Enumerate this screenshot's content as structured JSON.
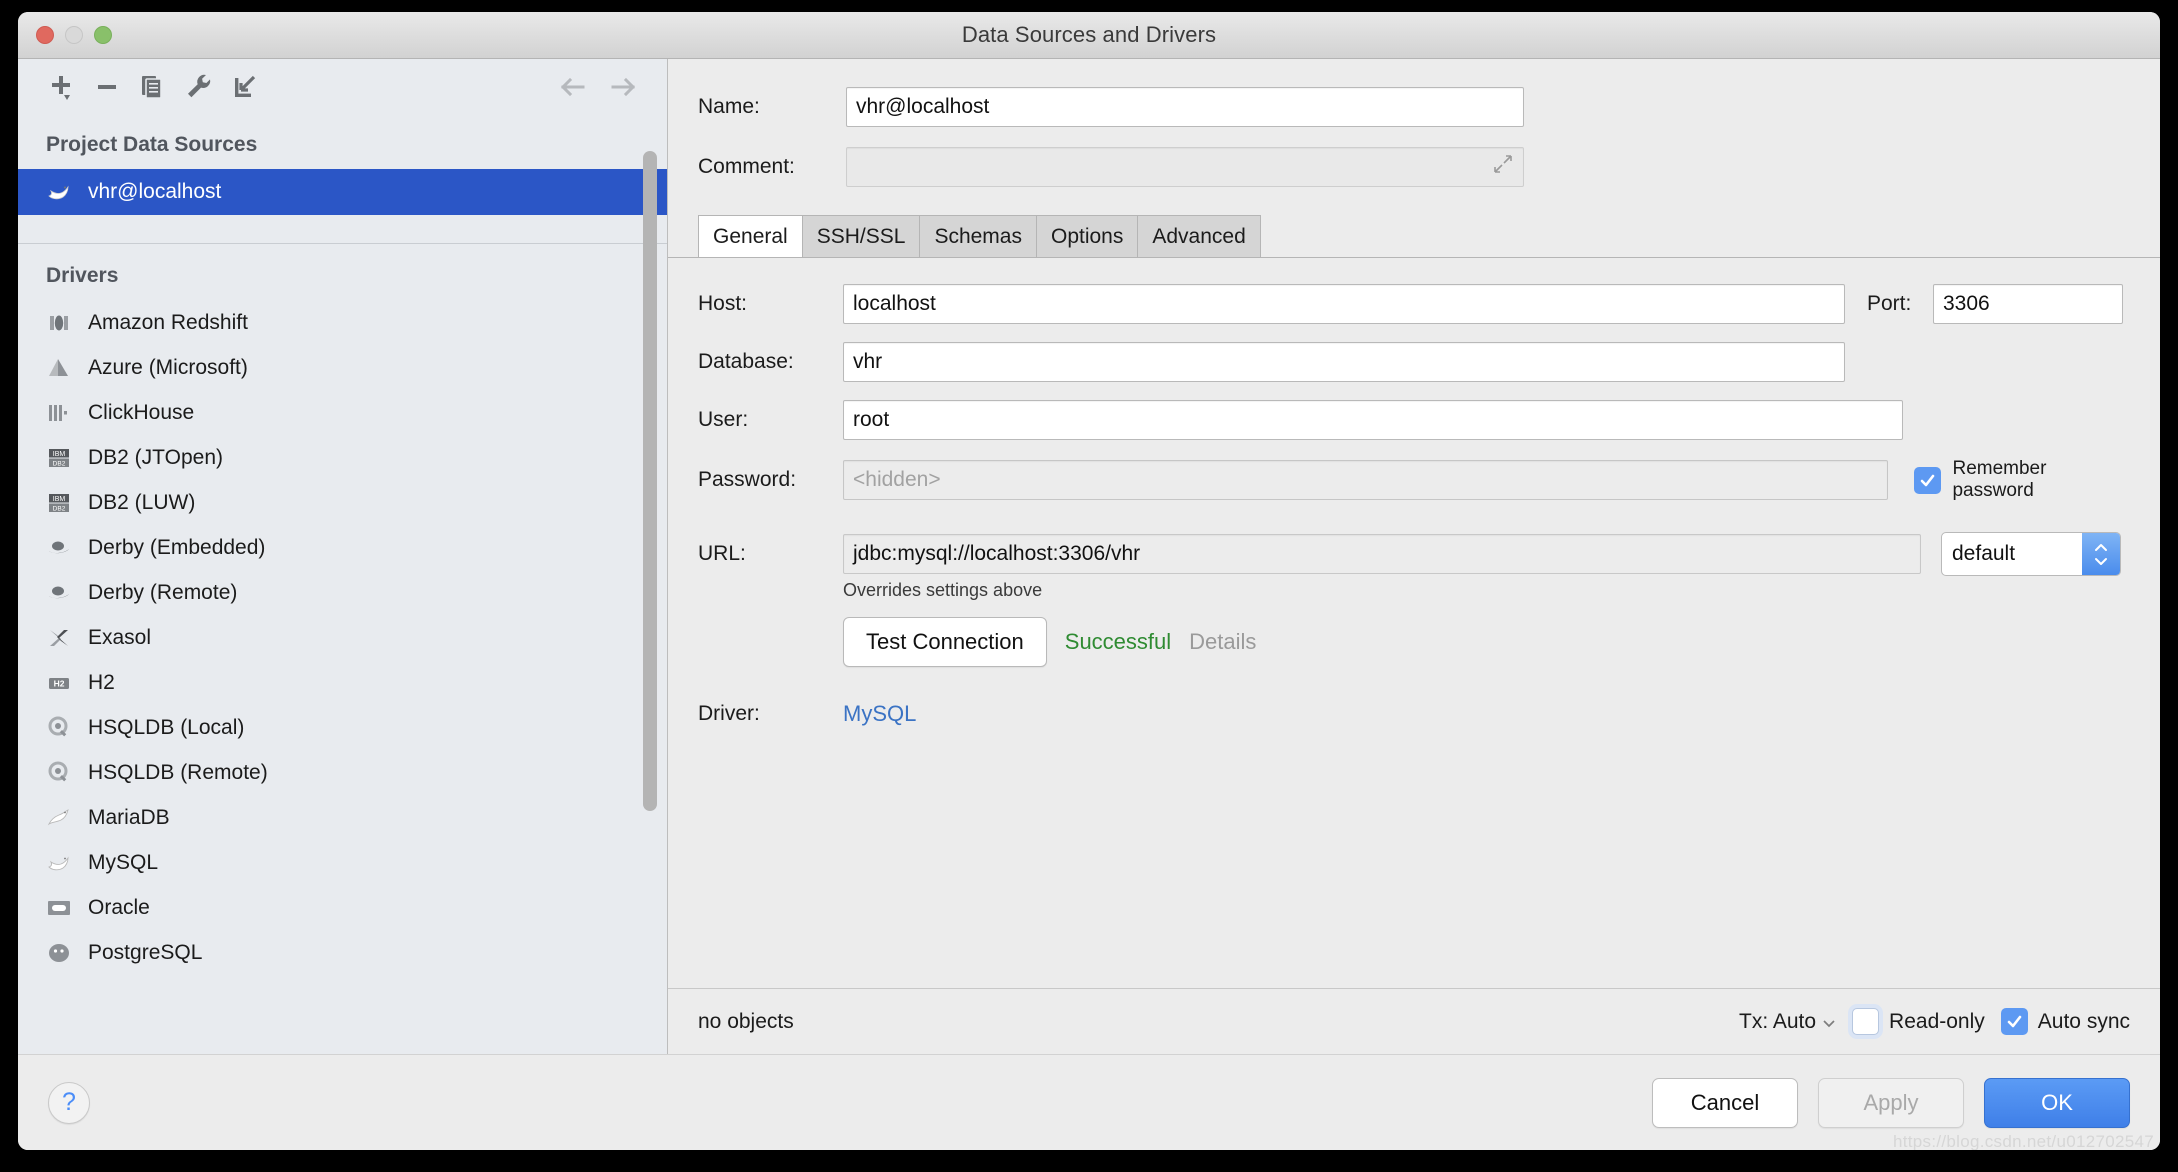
{
  "window": {
    "title": "Data Sources and Drivers",
    "traffic_lights": [
      "close",
      "minimize",
      "zoom"
    ]
  },
  "left_panel": {
    "toolbar": [
      {
        "name": "add-button",
        "icon": "plus-icon",
        "label": "+"
      },
      {
        "name": "remove-button",
        "icon": "minus-icon",
        "label": "−"
      },
      {
        "name": "copy-button",
        "icon": "copy-icon",
        "label": "Copy"
      },
      {
        "name": "settings-button",
        "icon": "wrench-icon",
        "label": "Settings"
      },
      {
        "name": "import-button",
        "icon": "import-arrow-icon",
        "label": "Import"
      }
    ],
    "nav": [
      {
        "name": "back-button",
        "icon": "arrow-left-icon"
      },
      {
        "name": "forward-button",
        "icon": "arrow-right-icon"
      }
    ],
    "project_sources_title": "Project Data Sources",
    "data_sources": [
      {
        "label": "vhr@localhost",
        "icon": "mysql-dolphin-icon",
        "selected": true
      }
    ],
    "drivers_title": "Drivers",
    "drivers": [
      {
        "label": "Amazon Redshift",
        "icon": "redshift-icon"
      },
      {
        "label": "Azure (Microsoft)",
        "icon": "azure-icon"
      },
      {
        "label": "ClickHouse",
        "icon": "clickhouse-icon"
      },
      {
        "label": "DB2 (JTOpen)",
        "icon": "db2-icon"
      },
      {
        "label": "DB2 (LUW)",
        "icon": "db2-icon"
      },
      {
        "label": "Derby (Embedded)",
        "icon": "derby-hat-icon"
      },
      {
        "label": "Derby (Remote)",
        "icon": "derby-hat-icon"
      },
      {
        "label": "Exasol",
        "icon": "exasol-x-icon"
      },
      {
        "label": "H2",
        "icon": "h2-icon"
      },
      {
        "label": "HSQLDB (Local)",
        "icon": "hsqldb-icon"
      },
      {
        "label": "HSQLDB (Remote)",
        "icon": "hsqldb-icon"
      },
      {
        "label": "MariaDB",
        "icon": "mariadb-seal-icon"
      },
      {
        "label": "MySQL",
        "icon": "mysql-dolphin-icon"
      },
      {
        "label": "Oracle",
        "icon": "oracle-icon"
      },
      {
        "label": "PostgreSQL",
        "icon": "postgresql-icon"
      }
    ]
  },
  "right_panel": {
    "name_label": "Name:",
    "name_value": "vhr@localhost",
    "comment_label": "Comment:",
    "comment_value": "",
    "tabs": [
      {
        "label": "General",
        "active": true
      },
      {
        "label": "SSH/SSL",
        "active": false
      },
      {
        "label": "Schemas",
        "active": false
      },
      {
        "label": "Options",
        "active": false
      },
      {
        "label": "Advanced",
        "active": false
      }
    ],
    "general": {
      "host_label": "Host:",
      "host_value": "localhost",
      "port_label": "Port:",
      "port_value": "3306",
      "database_label": "Database:",
      "database_value": "vhr",
      "user_label": "User:",
      "user_value": "root",
      "password_label": "Password:",
      "password_placeholder": "<hidden>",
      "remember_password_label": "Remember password",
      "remember_password_checked": true,
      "url_label": "URL:",
      "url_value": "jdbc:mysql://localhost:3306/vhr",
      "url_driver_select": "default",
      "overrides_note": "Overrides settings above",
      "test_connection_label": "Test Connection",
      "test_status": "Successful",
      "test_details_label": "Details",
      "driver_label": "Driver:",
      "driver_value": "MySQL"
    },
    "statusbar": {
      "objects_text": "no objects",
      "tx_label": "Tx: Auto",
      "readonly_label": "Read-only",
      "readonly_checked": false,
      "autosync_label": "Auto sync",
      "autosync_checked": true
    }
  },
  "footer": {
    "help_label": "?",
    "cancel_label": "Cancel",
    "apply_label": "Apply",
    "apply_disabled": true,
    "ok_label": "OK"
  },
  "watermark": "https://blog.csdn.net/u012702547",
  "colors": {
    "selection_blue": "#2b56c6",
    "primary_button": "#4a8cec",
    "success_green": "#2f8b32",
    "link_blue": "#3b73c4",
    "panel_bg": "#ececec",
    "sidebar_bg": "#e8ebef"
  }
}
